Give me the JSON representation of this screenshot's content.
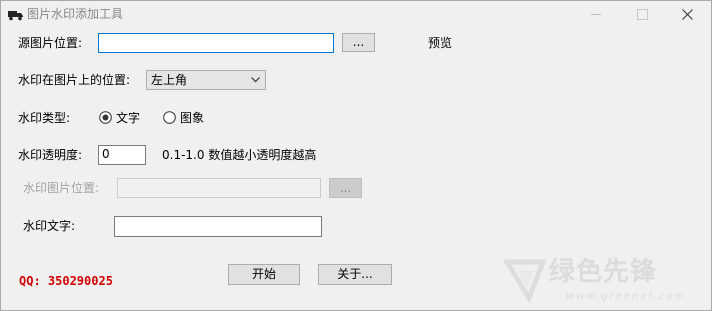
{
  "window": {
    "title": "图片水印添加工具",
    "controls": {
      "minimize": "minimize",
      "maximize": "maximize",
      "close": "close"
    }
  },
  "source": {
    "label": "源图片位置:",
    "value": "",
    "browse_label": "...",
    "preview_label": "预览"
  },
  "position": {
    "label": "水印在图片上的位置:",
    "selected": "左上角"
  },
  "type": {
    "label": "水印类型:",
    "options": [
      {
        "label": "文字",
        "checked": true
      },
      {
        "label": "图象",
        "checked": false
      }
    ]
  },
  "opacity": {
    "label": "水印透明度:",
    "value": "0",
    "hint": "0.1-1.0 数值越小透明度越高"
  },
  "watermark_image": {
    "label": "水印图片位置:",
    "value": "",
    "browse_label": "..."
  },
  "watermark_text": {
    "label": "水印文字:",
    "value": ""
  },
  "actions": {
    "start_label": "开始",
    "about_label": "关于..."
  },
  "contact": {
    "qq": "QQ: 350290025"
  },
  "site_watermark": {
    "name": "绿色先锋",
    "url": "www.greenxf.com"
  },
  "colors": {
    "accent": "#0078d7",
    "qq_red": "#d10000",
    "window_bg": "#f0f0f0"
  }
}
